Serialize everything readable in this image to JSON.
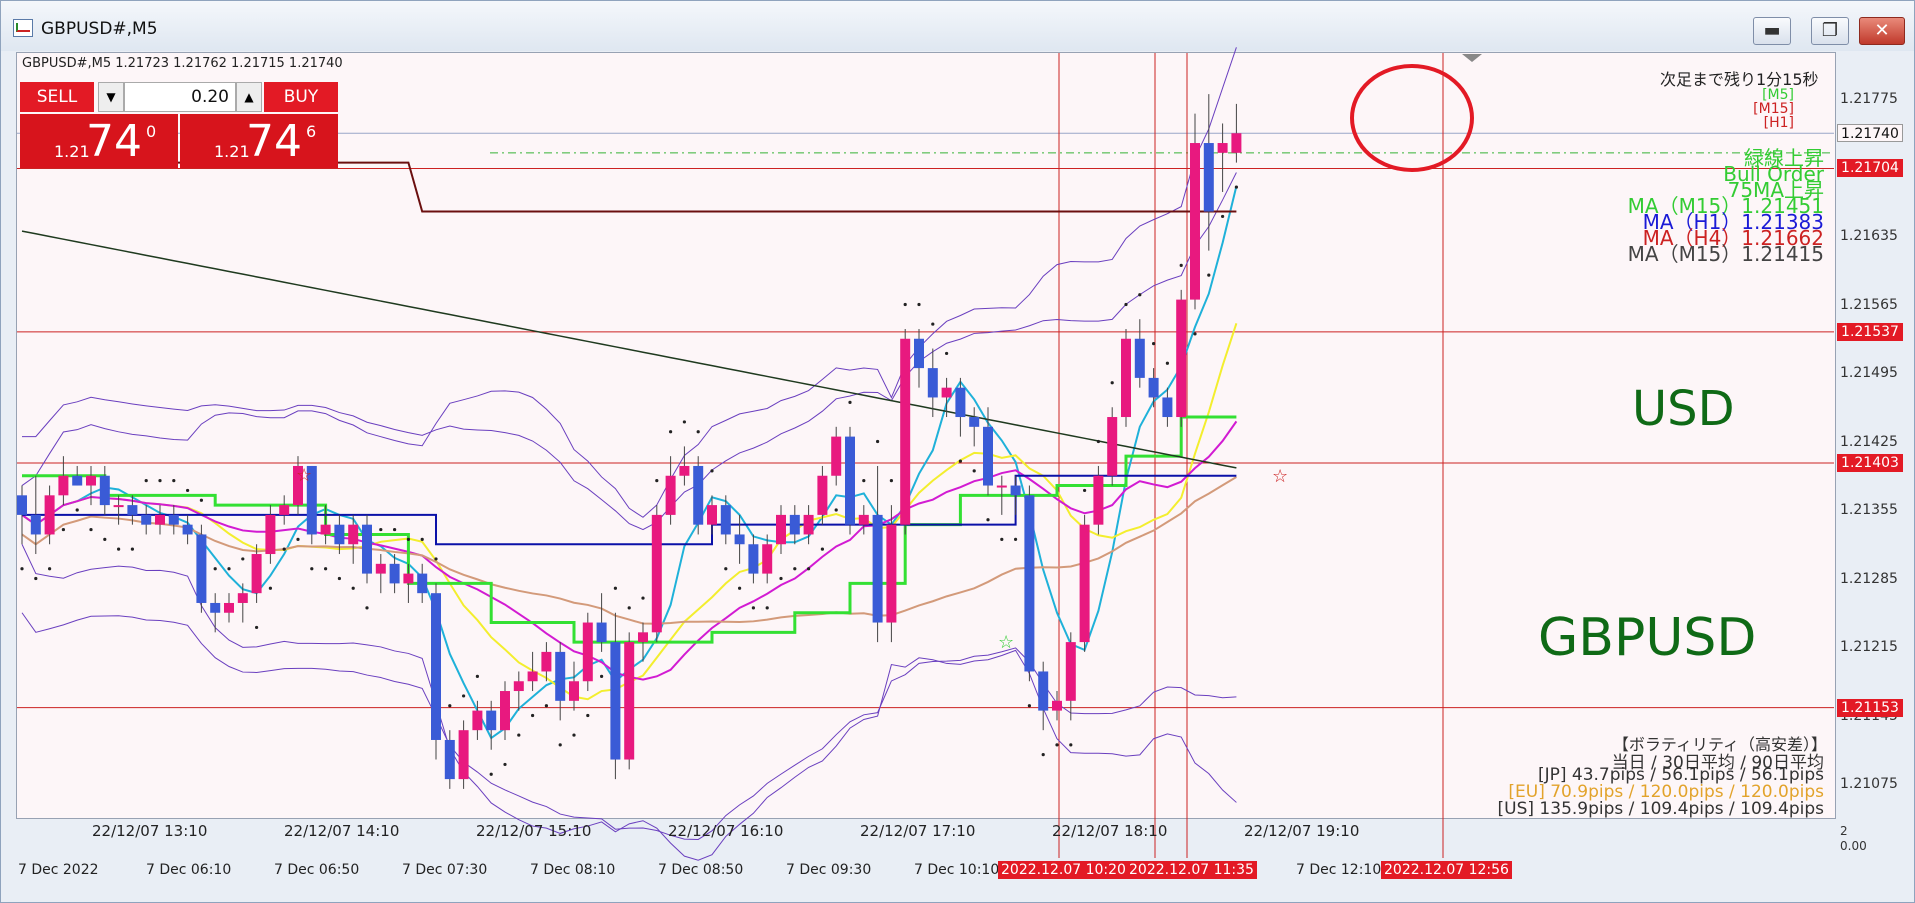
{
  "window": {
    "title": "GBPUSD#,M5",
    "minimize": "▬",
    "maximize": "❐",
    "close": "✕"
  },
  "chart": {
    "symbol_line": "GBPUSD#,M5  1.21723 1.21762 1.21715 1.21740",
    "countdown": "次足まで残り1分15秒",
    "tf_tags": [
      "[M5]",
      "[M15]",
      "[H1]"
    ],
    "signals": [
      {
        "text": "緑線上昇",
        "color": "#33cc33"
      },
      {
        "text": "Bull Order",
        "color": "#33cc33"
      },
      {
        "text": "75MA上昇",
        "color": "#33cc33"
      },
      {
        "text": "MA（M15）1.21451",
        "color": "#33cc33"
      },
      {
        "text": "MA（H1）1.21383",
        "color": "#1a1ad6"
      },
      {
        "text": "MA（H4）1.21662",
        "color": "#cc2222"
      },
      {
        "text": "MA（M15）1.21415",
        "color": "#444444"
      }
    ],
    "watermark_currency": "USD",
    "watermark_pair": "GBPUSD",
    "volatility": {
      "title": "【ボラティリティ（高安差）】",
      "lines": [
        {
          "text": "当日 / 30日平均 / 90日平均",
          "color": "#333333"
        },
        {
          "text": "[JP] 43.7pips / 56.1pips / 56.1pips",
          "color": "#333333"
        },
        {
          "text": "[EU] 70.9pips / 120.0pips / 120.0pips",
          "color": "#e2a32b"
        },
        {
          "text": "[US] 135.9pips / 109.4pips / 109.4pips",
          "color": "#333333"
        }
      ]
    }
  },
  "trade_panel": {
    "sell_label": "SELL",
    "buy_label": "BUY",
    "volume": "0.20",
    "sell_price": {
      "prefix": "1.21",
      "big": "74",
      "sup": "0"
    },
    "buy_price": {
      "prefix": "1.21",
      "big": "74",
      "sup": "6"
    }
  },
  "price_axis": {
    "labels": [
      "1.21775",
      "1.21705",
      "1.21635",
      "1.21565",
      "1.21495",
      "1.21425",
      "1.21355",
      "1.21285",
      "1.21215",
      "1.21145",
      "1.21075"
    ],
    "badges": [
      {
        "text": "1.21740",
        "style": "gray"
      },
      {
        "text": "1.21704",
        "style": "red"
      },
      {
        "text": "1.21537",
        "style": "red"
      },
      {
        "text": "1.21403",
        "style": "red"
      },
      {
        "text": "1.21153",
        "style": "red"
      }
    ]
  },
  "sub_time_axis": [
    "22/12/07 13:10",
    "22/12/07 14:10",
    "22/12/07 15:10",
    "22/12/07 16:10",
    "22/12/07 17:10",
    "22/12/07 18:10",
    "22/12/07 19:10"
  ],
  "sub_axis_values": [
    "2",
    "0.00"
  ],
  "bottom_time_axis": [
    "7 Dec 2022",
    "7 Dec 06:10",
    "7 Dec 06:50",
    "7 Dec 07:30",
    "7 Dec 08:10",
    "7 Dec 08:50",
    "7 Dec 09:30",
    "7 Dec 10:10",
    "7 Dec 12:10"
  ],
  "bottom_time_markers": [
    "2022.12.07 10:20",
    "2022.12.07 11:35",
    "2022.12.07 12:56"
  ],
  "colors": {
    "bull": "#e8197f",
    "bear": "#3a5bd6",
    "sell_red": "#e31a25",
    "lime": "#33e033",
    "yellow": "#f3ee2e",
    "magenta": "#d21bd2",
    "cyan": "#1fb1d9",
    "navy": "#0b11a8",
    "olive": "#1f3a1f",
    "darkred": "#6b0f0f",
    "violet": "#6a3fbf",
    "tan": "#d39a7a"
  }
}
